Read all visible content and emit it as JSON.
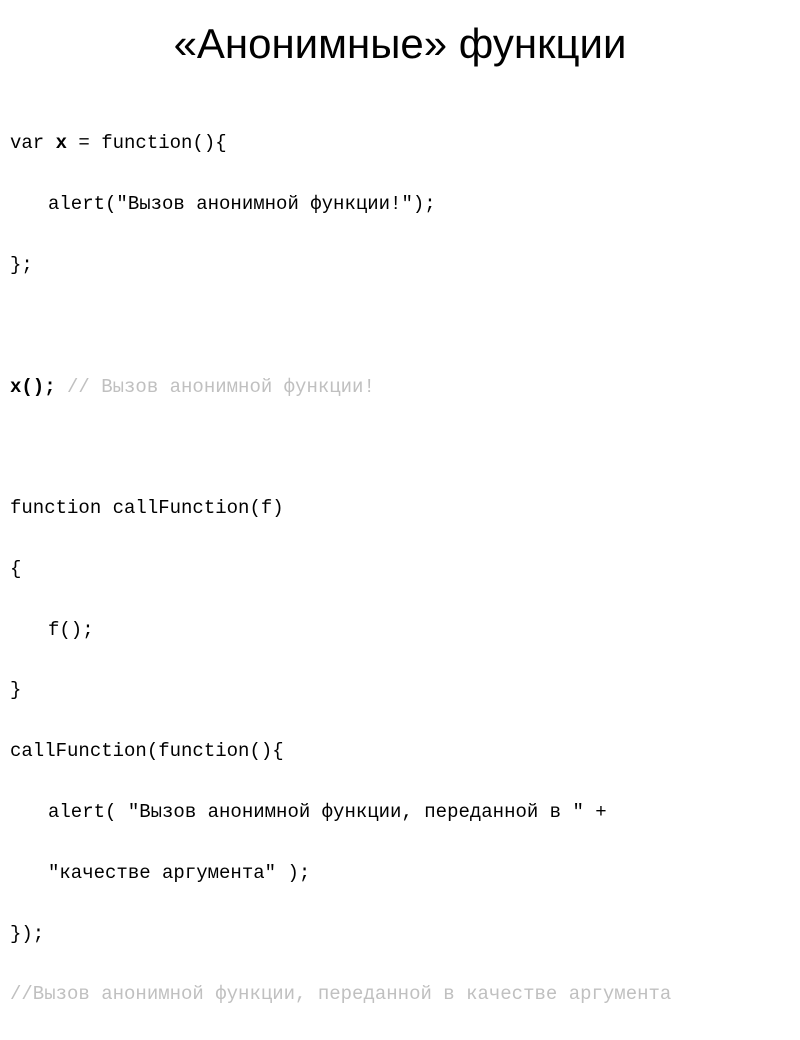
{
  "title": "«Анонимные» функции",
  "code": {
    "line1_part1": "var ",
    "line1_bold": "x",
    "line1_part2": " = function(){",
    "line2": "alert(\"Вызов анонимной функции!\");",
    "line3": "};",
    "line4_empty": "",
    "line5_bold": "x();",
    "line5_comment": " // Вызов анонимной функции!",
    "line6_empty": "",
    "line7": "function callFunction(f)",
    "line8": "{",
    "line9": "f();",
    "line10": "}",
    "line11": "callFunction(function(){",
    "line12": "alert( \"Вызов анонимной функции, переданной в \" +",
    "line13": "\"качестве аргумента\" );",
    "line14": "});",
    "line15_comment": "//Вызов анонимной функции, переданной в качестве аргумента"
  }
}
